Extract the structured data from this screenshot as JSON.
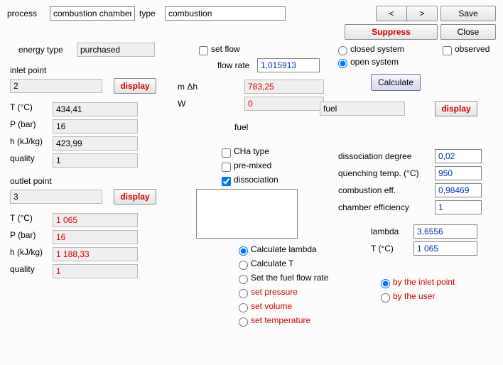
{
  "top": {
    "process_lbl": "process",
    "process_val": "combustion chamber",
    "type_lbl": "type",
    "type_val": "combustion",
    "prev_lbl": "<",
    "next_lbl": ">",
    "save_lbl": "Save",
    "suppress_lbl": "Suppress",
    "close_lbl": "Close"
  },
  "left": {
    "energy_type_lbl": "energy type",
    "energy_type_val": "purchased",
    "inlet_point_lbl": "inlet point",
    "inlet_point_val": "2",
    "display_lbl": "display",
    "in": {
      "t_lbl": "T (°C)",
      "t_val": "434,41",
      "p_lbl": "P (bar)",
      "p_val": "16",
      "h_lbl": "h (kJ/kg)",
      "h_val": "423,99",
      "q_lbl": "quality",
      "q_val": "1"
    },
    "outlet_point_lbl": "outlet point",
    "outlet_point_val": "3",
    "out": {
      "t_lbl": "T (°C)",
      "t_val": "1 065",
      "p_lbl": "P (bar)",
      "p_val": "16",
      "h_lbl": "h (kJ/kg)",
      "h_val": "1 188,33",
      "q_lbl": "quality",
      "q_val": "1"
    }
  },
  "mid": {
    "set_flow_lbl": "set flow",
    "flow_rate_lbl": "flow rate",
    "flow_rate_val": "1,015913",
    "mdh_lbl": "m Δh",
    "mdh_val": "783,25",
    "w_lbl": "W",
    "w_val": "0",
    "fuel_lbl": "fuel",
    "fuel_val": "fuel",
    "display_lbl": "display",
    "cha_lbl": "CHa type",
    "premixed_lbl": "pre-mixed",
    "dissoc_lbl": "dissociation",
    "opt_calc_lambda": "Calculate lambda",
    "opt_calc_t": "Calculate T",
    "opt_set_fuel": "Set the fuel flow rate",
    "opt_set_pressure": "set pressure",
    "opt_set_volume": "set volume",
    "opt_set_temp": "set temperature"
  },
  "right": {
    "sys_closed_lbl": "closed system",
    "sys_open_lbl": "open system",
    "observed_lbl": "observed",
    "calculate_lbl": "Calculate",
    "dissoc_deg_lbl": "dissociation degree",
    "dissoc_deg_val": "0,02",
    "quench_lbl": "quenching temp. (°C)",
    "quench_val": "950",
    "comb_eff_lbl": "combustion eff.",
    "comb_eff_val": "0,98469",
    "chamber_eff_lbl": "chamber efficiency",
    "chamber_eff_val": "1",
    "lambda_lbl": "lambda",
    "lambda_val": "3,6556",
    "t_lbl": "T (°C)",
    "t_val": "1 065",
    "by_inlet_lbl": "by the inlet point",
    "by_user_lbl": "by the user"
  }
}
